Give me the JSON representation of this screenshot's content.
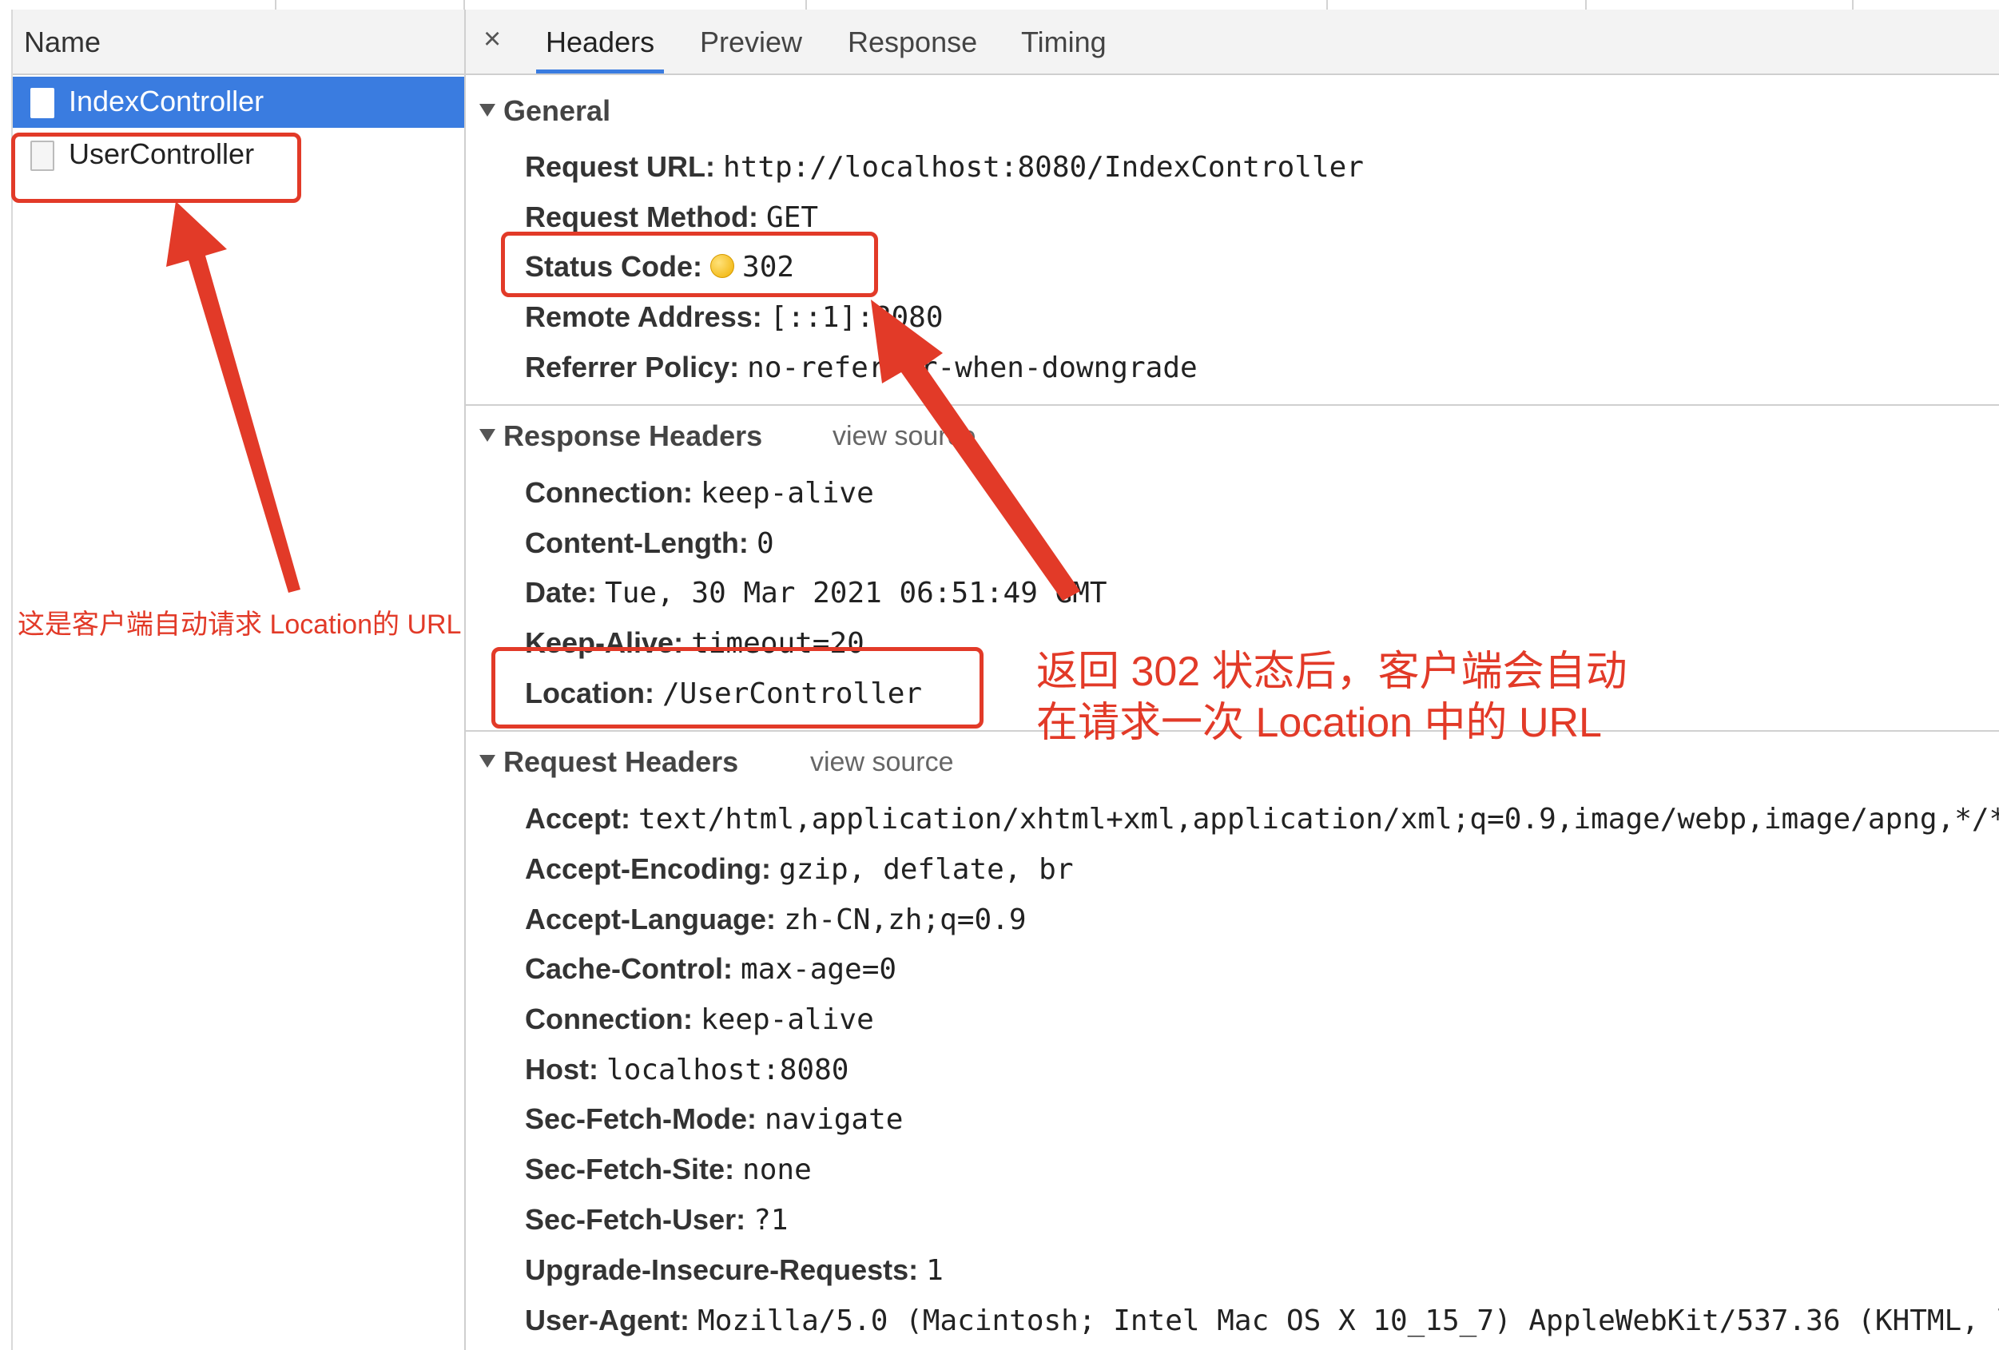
{
  "left_panel": {
    "header": "Name",
    "requests": [
      {
        "name": "IndexController",
        "selected": true
      },
      {
        "name": "UserController",
        "selected": false
      }
    ]
  },
  "tabs": {
    "close": "×",
    "items": [
      "Headers",
      "Preview",
      "Response",
      "Timing"
    ],
    "active": "Headers"
  },
  "general": {
    "title": "General",
    "rows": [
      {
        "key": "Request URL:",
        "value": "http://localhost:8080/IndexController"
      },
      {
        "key": "Request Method:",
        "value": "GET"
      },
      {
        "key": "Status Code:",
        "value": "302"
      },
      {
        "key": "Remote Address:",
        "value": "[::1]:8080"
      },
      {
        "key": "Referrer Policy:",
        "value": "no-referrer-when-downgrade"
      }
    ]
  },
  "response_headers": {
    "title": "Response Headers",
    "view_source": "view source",
    "rows": [
      {
        "key": "Connection:",
        "value": "keep-alive"
      },
      {
        "key": "Content-Length:",
        "value": "0"
      },
      {
        "key": "Date:",
        "value": "Tue, 30 Mar 2021 06:51:49 GMT"
      },
      {
        "key": "Keep-Alive:",
        "value": "timeout=20"
      },
      {
        "key": "Location:",
        "value": "/UserController"
      }
    ]
  },
  "request_headers": {
    "title": "Request Headers",
    "view_source": "view source",
    "rows": [
      {
        "key": "Accept:",
        "value": "text/html,application/xhtml+xml,application/xml;q=0.9,image/webp,image/apng,*/*"
      },
      {
        "key": "Accept-Encoding:",
        "value": "gzip, deflate, br"
      },
      {
        "key": "Accept-Language:",
        "value": "zh-CN,zh;q=0.9"
      },
      {
        "key": "Cache-Control:",
        "value": "max-age=0"
      },
      {
        "key": "Connection:",
        "value": "keep-alive"
      },
      {
        "key": "Host:",
        "value": "localhost:8080"
      },
      {
        "key": "Sec-Fetch-Mode:",
        "value": "navigate"
      },
      {
        "key": "Sec-Fetch-Site:",
        "value": "none"
      },
      {
        "key": "Sec-Fetch-User:",
        "value": "?1"
      },
      {
        "key": "Upgrade-Insecure-Requests:",
        "value": "1"
      },
      {
        "key": "User-Agent:",
        "value": "Mozilla/5.0 (Macintosh; Intel Mac OS X 10_15_7) AppleWebKit/537.36 (KHTML, l"
      }
    ]
  },
  "annotations": {
    "left_note": "这是客户端自动请求 Location的 URL",
    "right_note_line1": "返回 302 状态后，客户端会自动",
    "right_note_line2": "在请求一次 Location 中的 URL"
  },
  "colors": {
    "annotation_red": "#e23a28",
    "selection_blue": "#3a7ce0",
    "status_dot": "#f0b000"
  },
  "icons": {
    "request_doc": "document-icon",
    "collapse": "triangle-down-icon",
    "status": "status-dot-icon",
    "close": "close-icon"
  }
}
